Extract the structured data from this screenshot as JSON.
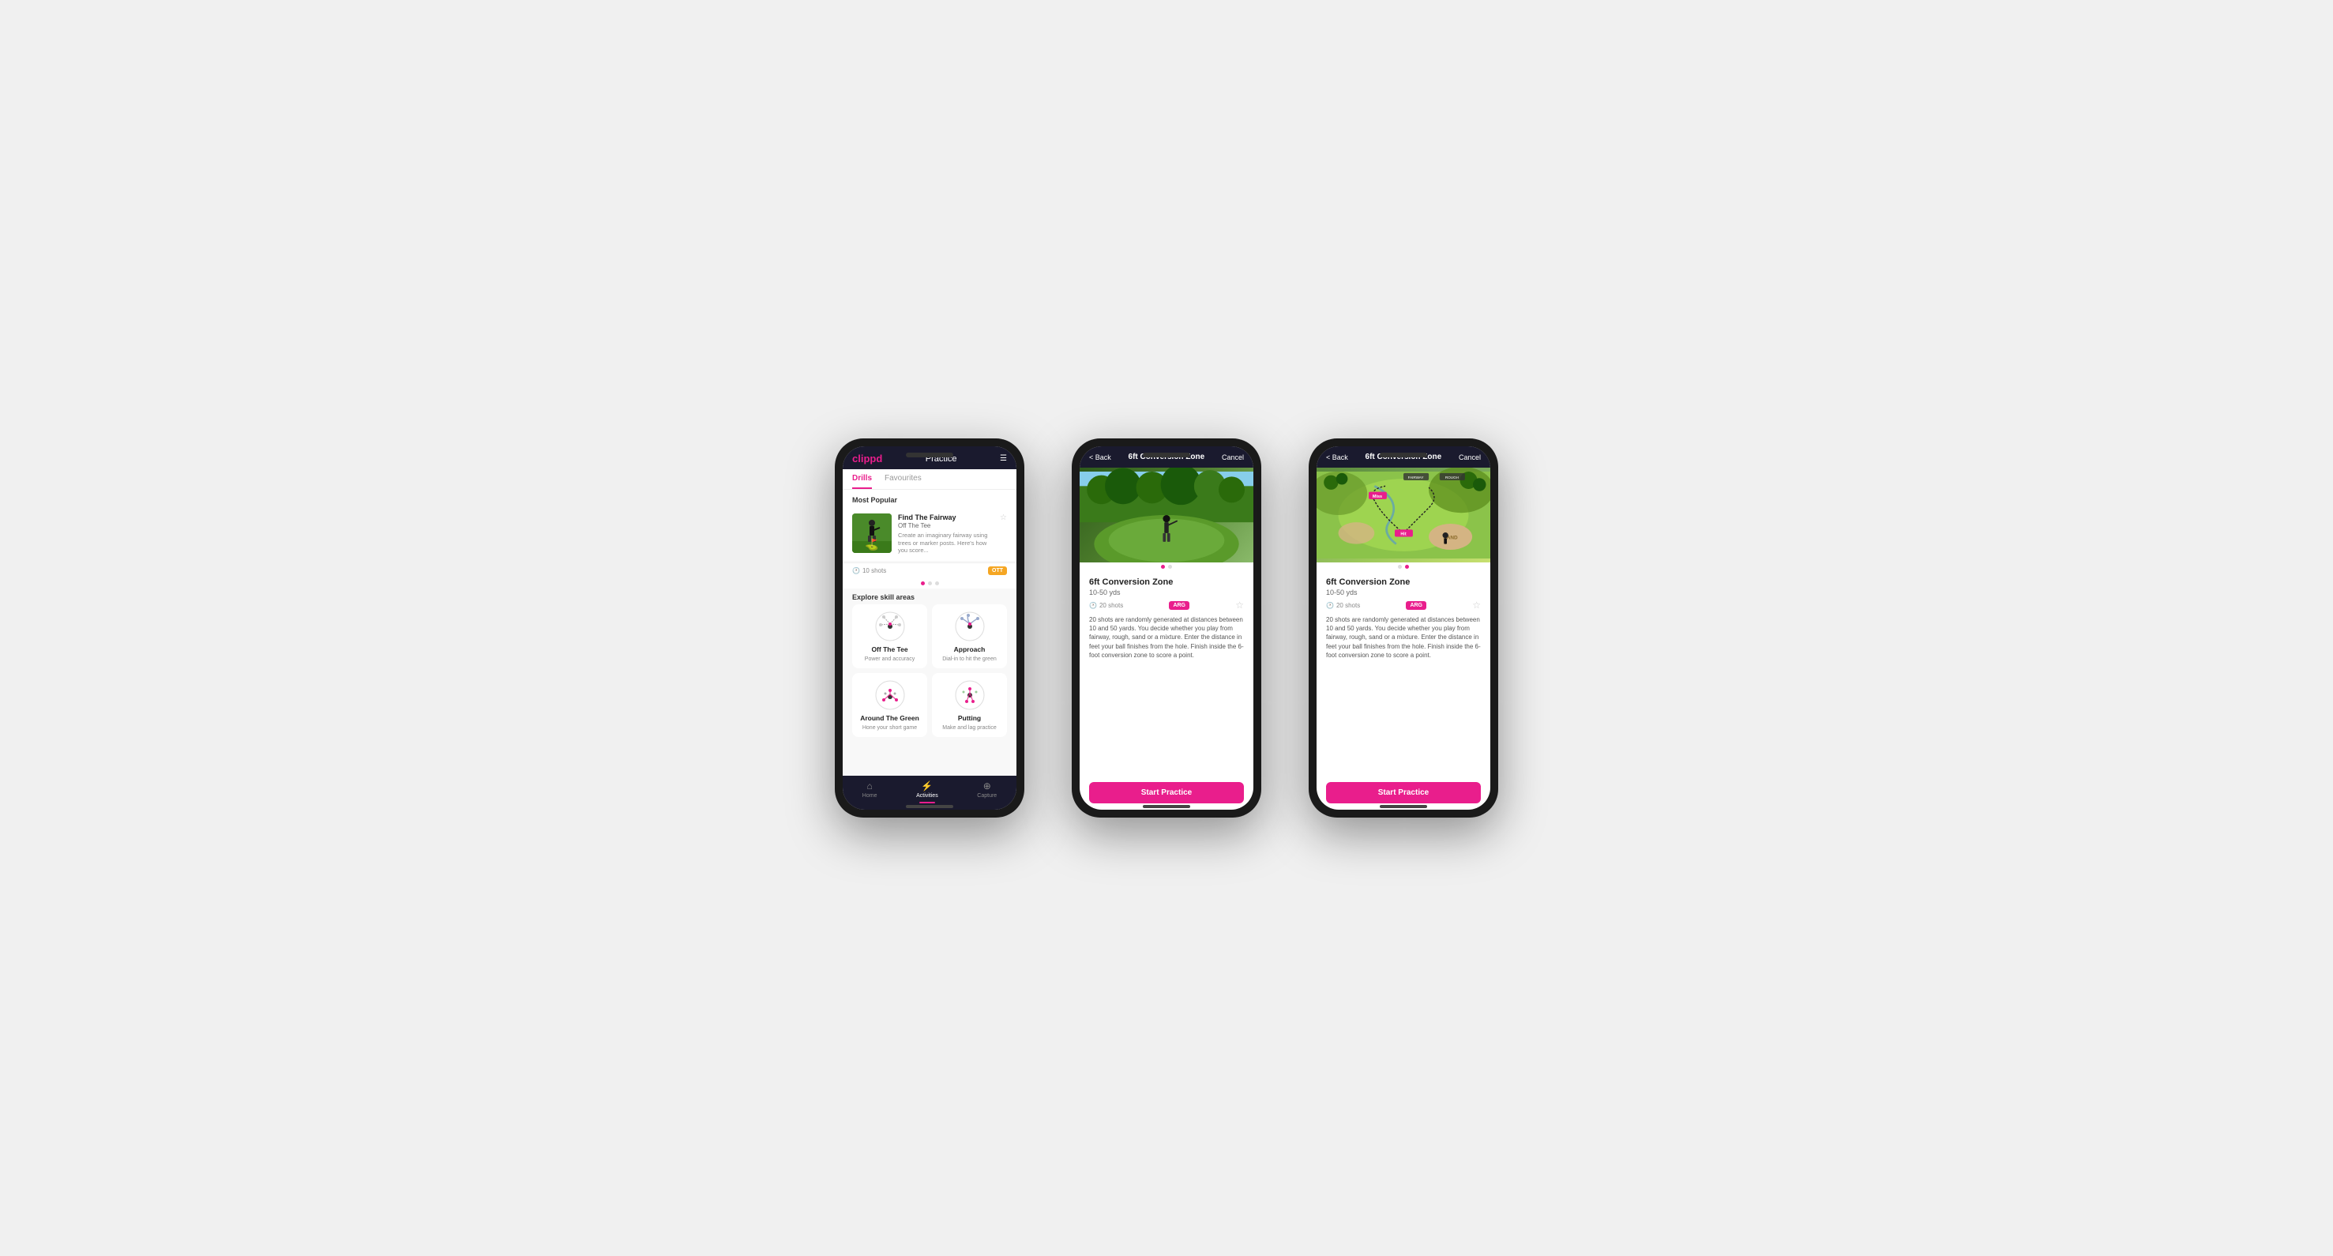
{
  "phone1": {
    "header": {
      "logo": "clippd",
      "title": "Practice",
      "menu_icon": "☰"
    },
    "tabs": [
      {
        "label": "Drills",
        "active": true
      },
      {
        "label": "Favourites",
        "active": false
      }
    ],
    "most_popular_label": "Most Popular",
    "featured_drill": {
      "title": "Find The Fairway",
      "subtitle": "Off The Tee",
      "description": "Create an imaginary fairway using trees or marker posts. Here's how you score...",
      "shots": "10 shots",
      "badge": "OTT"
    },
    "dots": [
      "active",
      "inactive",
      "inactive"
    ],
    "explore_label": "Explore skill areas",
    "skills": [
      {
        "name": "Off The Tee",
        "desc": "Power and accuracy",
        "icon_type": "ott"
      },
      {
        "name": "Approach",
        "desc": "Dial-in to hit the green",
        "icon_type": "approach"
      },
      {
        "name": "Around The Green",
        "desc": "Hone your short game",
        "icon_type": "atg"
      },
      {
        "name": "Putting",
        "desc": "Make and lag practice",
        "icon_type": "putting"
      }
    ],
    "nav": [
      {
        "label": "Home",
        "icon": "⌂",
        "active": false
      },
      {
        "label": "Activities",
        "icon": "⚡",
        "active": true
      },
      {
        "label": "Capture",
        "icon": "⊕",
        "active": false
      }
    ]
  },
  "phone2": {
    "header": {
      "back": "< Back",
      "title": "6ft Conversion Zone",
      "cancel": "Cancel"
    },
    "drill_title": "6ft Conversion Zone",
    "yds": "10-50 yds",
    "shots": "20 shots",
    "badge": "ARG",
    "description": "20 shots are randomly generated at distances between 10 and 50 yards. You decide whether you play from fairway, rough, sand or a mixture. Enter the distance in feet your ball finishes from the hole. Finish inside the 6-foot conversion zone to score a point.",
    "dots": [
      "active",
      "inactive"
    ],
    "star": "☆",
    "start_btn": "Start Practice"
  },
  "phone3": {
    "header": {
      "back": "< Back",
      "title": "6ft Conversion Zone",
      "cancel": "Cancel"
    },
    "drill_title": "6ft Conversion Zone",
    "yds": "10-50 yds",
    "shots": "20 shots",
    "badge": "ARG",
    "description": "20 shots are randomly generated at distances between 10 and 50 yards. You decide whether you play from fairway, rough, sand or a mixture. Enter the distance in feet your ball finishes from the hole. Finish inside the 6-foot conversion zone to score a point.",
    "dots": [
      "inactive",
      "active"
    ],
    "star": "☆",
    "start_btn": "Start Practice"
  }
}
